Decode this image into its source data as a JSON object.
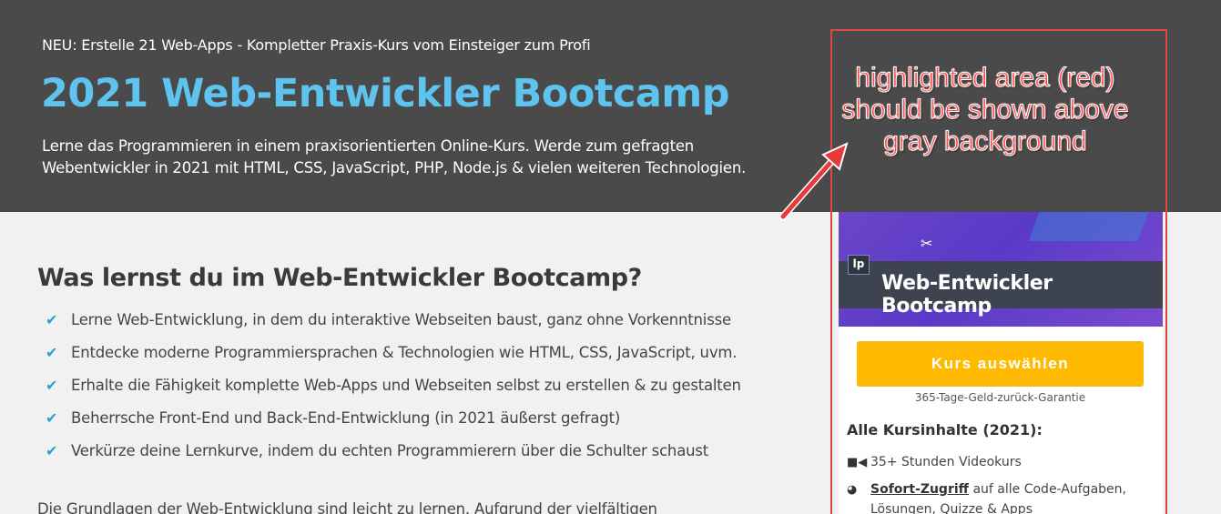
{
  "hero": {
    "eyebrow": "NEU: Erstelle 21 Web-Apps  - Kompletter Praxis-Kurs vom Einsteiger zum Profi",
    "title": "2021 Web-Entwickler Bootcamp",
    "description_line1": "Lerne das Programmieren in einem praxisorientierten Online-Kurs. Werde zum gefragten",
    "description_line2": "Webentwickler in 2021 mit HTML, CSS, JavaScript, PHP, Node.js & vielen weiteren Technologien."
  },
  "main": {
    "section_title": "Was lernst du im Web-Entwickler Bootcamp?",
    "checklist": [
      "Lerne Web-Entwicklung, in dem du interaktive Webseiten baust, ganz ohne Vorkenntnisse",
      "Entdecke moderne Programmiersprachen & Technologien wie HTML, CSS, JavaScript, uvm.",
      "Erhalte die Fähigkeit komplette Web-Apps und Webseiten selbst zu erstellen & zu gestalten",
      "Beherrsche Front-End und Back-End-Entwicklung (in 2021 äußerst gefragt)",
      "Verkürze deine Lernkurve, indem du echten Programmierern über die Schulter schaust"
    ],
    "check_icon": "check-icon",
    "intro_text": "Die Grundlagen der Web-Entwicklung sind leicht zu lernen. Aufgrund der vielfältigen"
  },
  "annotation": {
    "line1": "highlighted area (red)",
    "line2": "should be shown above",
    "line3": "gray background",
    "color": "#ff4b4b"
  },
  "card": {
    "logo": "lp",
    "image_title": "Web-Entwickler Bootcamp",
    "button_label": "Kurs auswählen",
    "button_color": "#ffb900",
    "guarantee": "365-Tage-Geld-zurück-Garantie",
    "contents_title": "Alle Kursinhalte (2021):",
    "feature1": "35+ Stunden Videokurs",
    "feature2_link": "Sofort-Zugriff",
    "feature2_rest": " auf alle Code-Aufgaben,",
    "feature2_line2": "Lösungen, Quizze & Apps",
    "border_color": "#e04646"
  },
  "colors": {
    "hero_bg": "#4a4a4a",
    "title_blue": "#5ec4ef",
    "page_bg": "#f1f1f1"
  }
}
